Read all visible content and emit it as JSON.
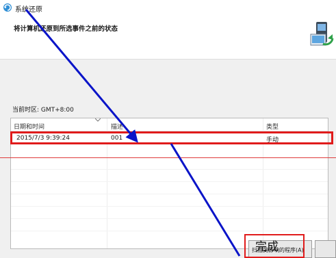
{
  "window": {
    "title": "系统还原"
  },
  "header": {
    "heading": "将计算机还原到所选事件之前的状态"
  },
  "timezone": "当前时区: GMT+8:00",
  "table": {
    "columns": [
      "日期和时间",
      "描述",
      "类型"
    ],
    "rows": [
      {
        "datetime": "2015/7/3 9:39:24",
        "description": "001",
        "type": "手动"
      }
    ]
  },
  "buttons": {
    "scan": "扫描受影响的程序(A)",
    "finish_overlay": "完成"
  },
  "annotation_colors": {
    "arrow": "#0a14c8",
    "highlight": "#e01b1b"
  }
}
